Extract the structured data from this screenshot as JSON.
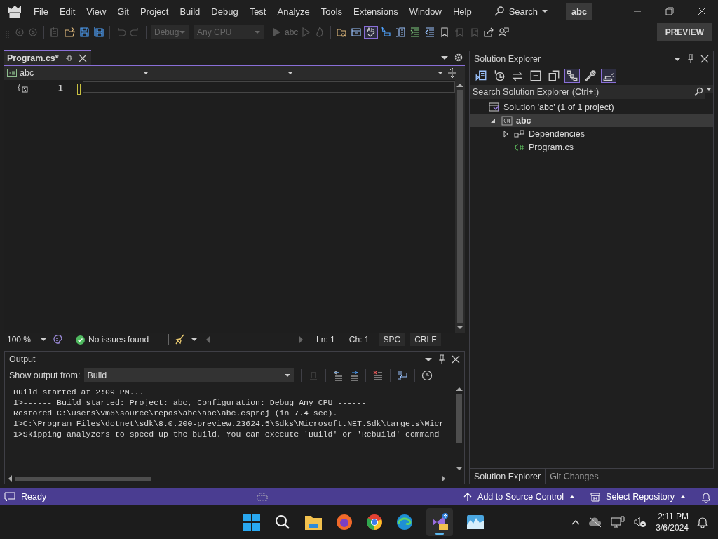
{
  "menu": {
    "items": [
      "File",
      "Edit",
      "View",
      "Git",
      "Project",
      "Build",
      "Debug",
      "Test",
      "Analyze",
      "Tools",
      "Extensions",
      "Window",
      "Help"
    ]
  },
  "search": {
    "label": "Search"
  },
  "solution_badge": "abc",
  "toolbar": {
    "configuration": "Debug",
    "platform": "Any CPU",
    "start_target": "abc",
    "preview_button": "PREVIEW"
  },
  "editor_tab": {
    "title": "Program.cs*",
    "selected": true
  },
  "editor": {
    "project_dropdown": "abc",
    "line_numbers": [
      "1"
    ],
    "zoom": "100 %",
    "issues": "No issues found",
    "line": "Ln: 1",
    "char": "Ch: 1",
    "indent": "SPC",
    "line_ending": "CRLF"
  },
  "output": {
    "title": "Output",
    "source_label": "Show output from:",
    "source": "Build",
    "lines": [
      "Build started at 2:09 PM...",
      "1>------ Build started: Project: abc, Configuration: Debug Any CPU ------",
      "Restored C:\\Users\\vm6\\source\\repos\\abc\\abc\\abc.csproj (in 7.4 sec).",
      "1>C:\\Program Files\\dotnet\\sdk\\8.0.200-preview.23624.5\\Sdks\\Microsoft.NET.Sdk\\targets\\Micr",
      "1>Skipping analyzers to speed up the build. You can execute 'Build' or 'Rebuild' command"
    ]
  },
  "solution_explorer": {
    "title": "Solution Explorer",
    "search_placeholder": "Search Solution Explorer (Ctrl+;)",
    "tree": [
      {
        "label": "Solution 'abc' (1 of 1 project)",
        "kind": "solution",
        "selected": false,
        "children": [
          {
            "label": "abc",
            "kind": "project",
            "expanded": true,
            "selected": true,
            "children": [
              {
                "label": "Dependencies",
                "kind": "dependencies",
                "expanded": false,
                "selected": false
              },
              {
                "label": "Program.cs",
                "kind": "csharp-file",
                "selected": false
              }
            ]
          }
        ]
      }
    ],
    "tabs": [
      {
        "label": "Solution Explorer",
        "selected": true
      },
      {
        "label": "Git Changes",
        "selected": false
      }
    ]
  },
  "status_bar": {
    "state": "Ready",
    "source_control": "Add to Source Control",
    "repository": "Select Repository"
  },
  "taskbar": {
    "time": "2:11 PM",
    "date": "3/6/2024"
  }
}
